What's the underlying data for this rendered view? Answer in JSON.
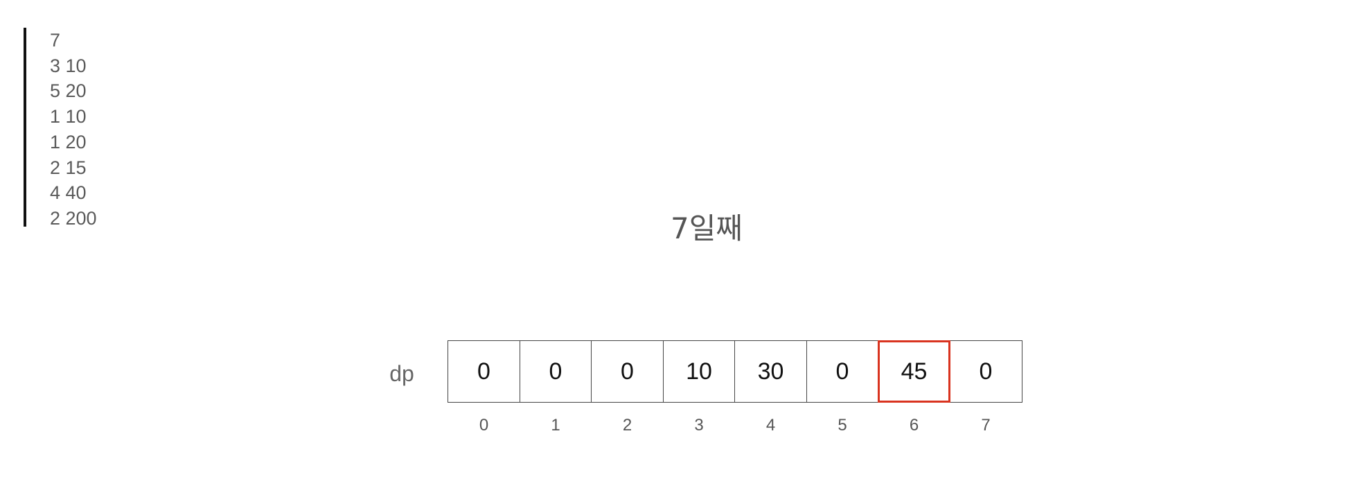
{
  "input_lines": [
    "7",
    "3 10",
    "5 20",
    "1 10",
    "1 20",
    "2 15",
    "4 40",
    "2 200"
  ],
  "day_title": "7일째",
  "array_label": "dp",
  "dp_values": [
    "0",
    "0",
    "0",
    "10",
    "30",
    "0",
    "45",
    "0"
  ],
  "indices": [
    "0",
    "1",
    "2",
    "3",
    "4",
    "5",
    "6",
    "7"
  ],
  "highlight_index": 6,
  "highlight_color": "#d9331f"
}
